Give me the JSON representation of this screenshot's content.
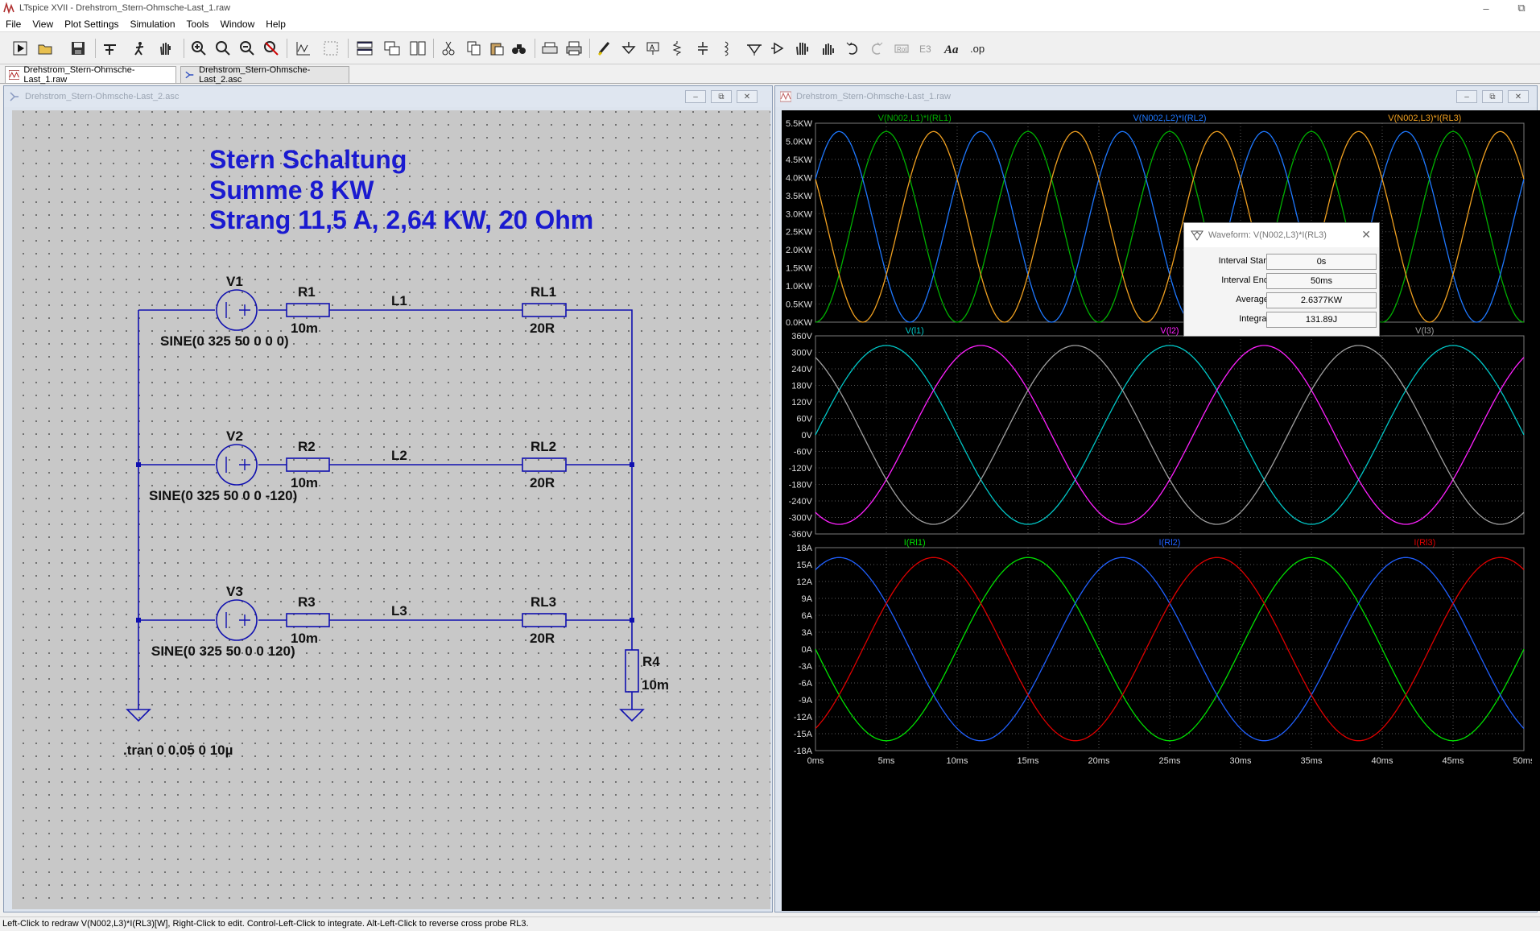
{
  "window": {
    "title": "LTspice XVII - Drehstrom_Stern-Ohmsche-Last_1.raw",
    "minimize": "–",
    "restore": "⧉",
    "close": "✕"
  },
  "menu": [
    "File",
    "View",
    "Plot Settings",
    "Simulation",
    "Tools",
    "Window",
    "Help"
  ],
  "toolbar_icons": [
    "run-icon",
    "open-icon",
    "save-icon",
    "control-panel-icon",
    "halt-icon",
    "pan-icon",
    "zoom-in-icon",
    "zoom-full-icon",
    "zoom-out-icon",
    "zoom-cancel-icon",
    "autorange-icon",
    "grid-icon",
    "tile-horizontal-icon",
    "cascade-icon",
    "tile-vertical-icon",
    "cut-icon",
    "copy-icon",
    "paste-icon",
    "find-icon",
    "print-setup-icon",
    "print-icon",
    "draw-wire-icon",
    "ground-icon",
    "label-net-icon",
    "resistor-icon",
    "capacitor-icon",
    "inductor-icon",
    "diode-icon",
    "component-icon",
    "move-icon",
    "drag-icon",
    "undo-icon",
    "redo-icon",
    "rotate-icon",
    "mirror-icon",
    "text-icon",
    "spice-directive-icon"
  ],
  "tabs": [
    {
      "label": "Drehstrom_Stern-Ohmsche-Last_1.raw",
      "icon": "waveform-icon"
    },
    {
      "label": "Drehstrom_Stern-Ohmsche-Last_2.asc",
      "icon": "schematic-icon"
    }
  ],
  "schematic_window": {
    "title": "Drehstrom_Stern-Ohmsche-Last_2.asc",
    "heading_lines": [
      "Stern Schaltung",
      "Summe 8 KW",
      "Strang 11,5 A, 2,64 KW, 20 Ohm"
    ],
    "components": {
      "V1": {
        "name": "V1",
        "value": "SINE(0 325 50 0 0 0)"
      },
      "V2": {
        "name": "V2",
        "value": "SINE(0 325 50 0 0 -120)"
      },
      "V3": {
        "name": "V3",
        "value": "SINE(0 325 50 0 0 120)"
      },
      "R1": {
        "name": "R1",
        "value": "10m"
      },
      "R2": {
        "name": "R2",
        "value": "10m"
      },
      "R3": {
        "name": "R3",
        "value": "10m"
      },
      "RL1": {
        "name": "RL1",
        "value": "20R"
      },
      "RL2": {
        "name": "RL2",
        "value": "20R"
      },
      "RL3": {
        "name": "RL3",
        "value": "20R"
      },
      "R4": {
        "name": "R4",
        "value": "10m"
      }
    },
    "net_labels": [
      "L1",
      "L2",
      "L3"
    ],
    "directive": ".tran 0 0.05 0 10µ"
  },
  "waveform_window": {
    "title": "Drehstrom_Stern-Ohmsche-Last_1.raw",
    "x_ticks": [
      "0ms",
      "5ms",
      "10ms",
      "15ms",
      "20ms",
      "25ms",
      "30ms",
      "35ms",
      "40ms",
      "45ms",
      "50ms"
    ]
  },
  "chart_data": [
    {
      "type": "line",
      "x_range_ms": [
        0,
        50
      ],
      "ylim": [
        0,
        5500
      ],
      "y_ticks": [
        "5.5KW",
        "5.0KW",
        "4.5KW",
        "4.0KW",
        "3.5KW",
        "3.0KW",
        "2.5KW",
        "2.0KW",
        "1.5KW",
        "1.0KW",
        "0.5KW",
        "0.0KW"
      ],
      "series": [
        {
          "name": "V(N002,L1)*I(RL1)",
          "color": "#00b000",
          "amplitude": 5270,
          "offset": 0,
          "frequency_hz": 50,
          "phase_deg": 0,
          "kind": "power"
        },
        {
          "name": "V(N002,L2)*I(RL2)",
          "color": "#1e78ff",
          "amplitude": 5270,
          "offset": 0,
          "frequency_hz": 50,
          "phase_deg": -120,
          "kind": "power"
        },
        {
          "name": "V(N002,L3)*I(RL3)",
          "color": "#f0a020",
          "amplitude": 5270,
          "offset": 0,
          "frequency_hz": 50,
          "phase_deg": 120,
          "kind": "power"
        }
      ]
    },
    {
      "type": "line",
      "x_range_ms": [
        0,
        50
      ],
      "ylim": [
        -360,
        360
      ],
      "y_ticks": [
        "360V",
        "300V",
        "240V",
        "180V",
        "120V",
        "60V",
        "0V",
        "-60V",
        "-120V",
        "-180V",
        "-240V",
        "-300V",
        "-360V"
      ],
      "series": [
        {
          "name": "V(l1)",
          "color": "#00c8c8",
          "amplitude": 325,
          "frequency_hz": 50,
          "phase_deg": 0,
          "kind": "sine"
        },
        {
          "name": "V(l2)",
          "color": "#ff20ff",
          "amplitude": 325,
          "frequency_hz": 50,
          "phase_deg": -120,
          "kind": "sine"
        },
        {
          "name": "V(l3)",
          "color": "#a0a0a0",
          "amplitude": 325,
          "frequency_hz": 50,
          "phase_deg": 120,
          "kind": "sine"
        }
      ]
    },
    {
      "type": "line",
      "x_range_ms": [
        0,
        50
      ],
      "ylim": [
        -18,
        18
      ],
      "y_ticks": [
        "18A",
        "15A",
        "12A",
        "9A",
        "6A",
        "3A",
        "0A",
        "-3A",
        "-6A",
        "-9A",
        "-12A",
        "-15A",
        "-18A"
      ],
      "series": [
        {
          "name": "I(Rl1)",
          "color": "#00e000",
          "amplitude": 16.25,
          "frequency_hz": 50,
          "phase_deg": 180,
          "kind": "sine"
        },
        {
          "name": "I(Rl2)",
          "color": "#2060ff",
          "amplitude": 16.25,
          "frequency_hz": 50,
          "phase_deg": 60,
          "kind": "sine"
        },
        {
          "name": "I(Rl3)",
          "color": "#e00000",
          "amplitude": 16.25,
          "frequency_hz": 50,
          "phase_deg": -60,
          "kind": "sine"
        }
      ]
    }
  ],
  "dialog": {
    "title": "Waveform: V(N002,L3)*I(RL3)",
    "interval_start_label": "Interval Start:",
    "interval_start": "0s",
    "interval_end_label": "Interval End:",
    "interval_end": "50ms",
    "average_label": "Average:",
    "average": "2.6377KW",
    "integral_label": "Integral:",
    "integral": "131.89J"
  },
  "status": "Left-Click to redraw V(N002,L3)*I(RL3)[W],  Right-Click to edit. Control-Left-Click to integrate. Alt-Left-Click to reverse cross probe RL3.",
  "colors": {
    "schematic_ink": "#1010b0",
    "text_dark": "#000000",
    "heading": "#1a1ad0"
  }
}
